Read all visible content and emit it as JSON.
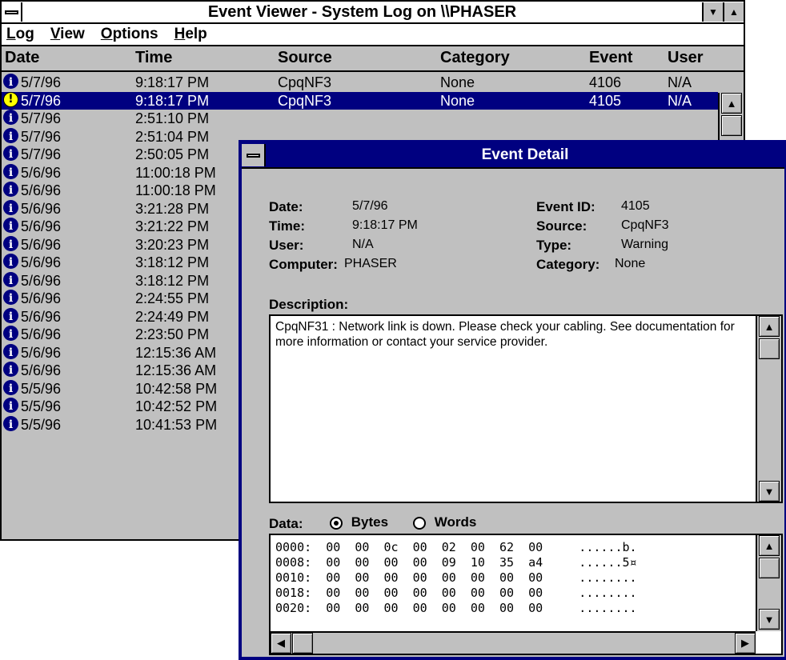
{
  "viewer": {
    "title": "Event Viewer - System Log on \\\\PHASER",
    "menu": [
      "Log",
      "View",
      "Options",
      "Help"
    ],
    "columns": [
      "Date",
      "Time",
      "Source",
      "Category",
      "Event",
      "User"
    ],
    "rows": [
      {
        "type": "info",
        "date": "5/7/96",
        "time": "9:18:17 PM",
        "source": "CpqNF3",
        "category": "None",
        "event": "4106",
        "user": "N/A"
      },
      {
        "type": "warning",
        "date": "5/7/96",
        "time": "9:18:17 PM",
        "source": "CpqNF3",
        "category": "None",
        "event": "4105",
        "user": "N/A",
        "selected": true
      },
      {
        "type": "info",
        "date": "5/7/96",
        "time": "2:51:10 PM"
      },
      {
        "type": "info",
        "date": "5/7/96",
        "time": "2:51:04 PM"
      },
      {
        "type": "info",
        "date": "5/7/96",
        "time": "2:50:05 PM"
      },
      {
        "type": "info",
        "date": "5/6/96",
        "time": "11:00:18 PM"
      },
      {
        "type": "info",
        "date": "5/6/96",
        "time": "11:00:18 PM"
      },
      {
        "type": "info",
        "date": "5/6/96",
        "time": "3:21:28 PM"
      },
      {
        "type": "info",
        "date": "5/6/96",
        "time": "3:21:22 PM"
      },
      {
        "type": "info",
        "date": "5/6/96",
        "time": "3:20:23 PM"
      },
      {
        "type": "info",
        "date": "5/6/96",
        "time": "3:18:12 PM"
      },
      {
        "type": "info",
        "date": "5/6/96",
        "time": "3:18:12 PM"
      },
      {
        "type": "info",
        "date": "5/6/96",
        "time": "2:24:55 PM"
      },
      {
        "type": "info",
        "date": "5/6/96",
        "time": "2:24:49 PM"
      },
      {
        "type": "info",
        "date": "5/6/96",
        "time": "2:23:50 PM"
      },
      {
        "type": "info",
        "date": "5/6/96",
        "time": "12:15:36 AM"
      },
      {
        "type": "info",
        "date": "5/6/96",
        "time": "12:15:36 AM"
      },
      {
        "type": "info",
        "date": "5/5/96",
        "time": "10:42:58 PM"
      },
      {
        "type": "info",
        "date": "5/5/96",
        "time": "10:42:52 PM"
      },
      {
        "type": "info",
        "date": "5/5/96",
        "time": "10:41:53 PM"
      }
    ]
  },
  "detail": {
    "title": "Event Detail",
    "labels": {
      "date": "Date:",
      "time": "Time:",
      "user": "User:",
      "computer": "Computer:",
      "event_id": "Event ID:",
      "source": "Source:",
      "type": "Type:",
      "category": "Category:",
      "description": "Description:",
      "data": "Data:",
      "bytes": "Bytes",
      "words": "Words"
    },
    "values": {
      "date": "5/7/96",
      "time": "9:18:17 PM",
      "user": "N/A",
      "computer": "PHASER",
      "event_id": "4105",
      "source": "CpqNF3",
      "type": "Warning",
      "category": "None"
    },
    "description": "CpqNF31 : Network link is down.  Please check your cabling.  See documentation for more information or contact your service provider.",
    "data_format_selected": "Bytes",
    "data_lines": [
      "0000:  00  00  0c  00  02  00  62  00     ......b.",
      "0008:  00  00  00  00  09  10  35  a4     ......5¤",
      "0010:  00  00  00  00  00  00  00  00     ........",
      "0018:  00  00  00  00  00  00  00  00     ........",
      "0020:  00  00  00  00  00  00  00  00     ........"
    ]
  },
  "colors": {
    "selection": "#000080",
    "window_bg": "#c0c0c0",
    "dialog_border": "#000080",
    "warning_icon": "#ffff00"
  }
}
